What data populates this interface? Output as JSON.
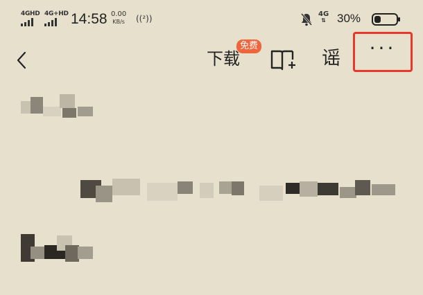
{
  "status_bar": {
    "sim1_label": "4GHD",
    "sim2_label": "4G+HD",
    "time": "14:58",
    "net_speed_value": "0.00",
    "net_speed_unit": "KB/s",
    "hotspot_icon": "((²))",
    "mobile_data_label": "4G",
    "battery_percent": "30%",
    "battery_level": 0.3
  },
  "toolbar": {
    "download_label": "下载",
    "free_badge": "免费",
    "rumor_label": "谣",
    "more_label": "···"
  },
  "colors": {
    "background": "#e7e0cd",
    "accent_badge": "#f0663c",
    "highlight_box": "#e8372b"
  },
  "content": {
    "line1_text": "",
    "line2_text": "",
    "line3_text": ""
  }
}
